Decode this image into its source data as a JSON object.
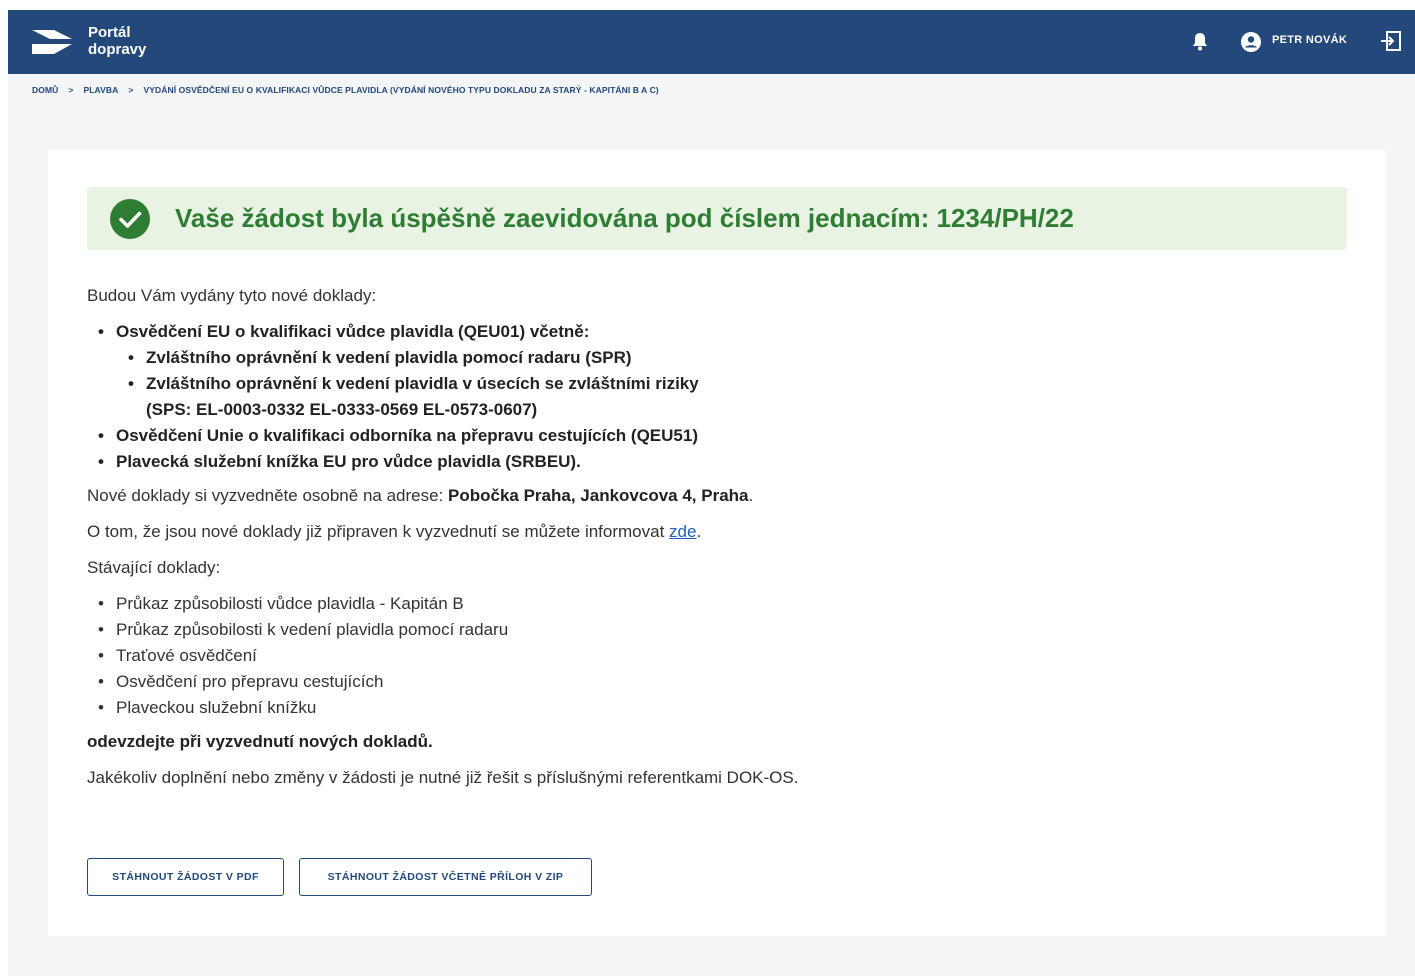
{
  "header": {
    "logo_line1": "Portál",
    "logo_line2": "dopravy",
    "user_name": "PETR NOVÁK",
    "icons": [
      "notification-bell-icon",
      "user-avatar-icon",
      "logout-icon"
    ]
  },
  "breadcrumb": {
    "items": [
      "DOMŮ",
      "PLAVBA",
      "VYDÁNÍ OSVĚDČENÍ EU O KVALIFIKACI VŮDCE PLAVIDLA (VYDÁNÍ NOVÉHO TYPU DOKLADU ZA STARÝ - KAPITÁNI B A C)"
    ],
    "separator": ">"
  },
  "success": {
    "message": "Vaše žádost byla úspěšně zaevidována pod číslem jednacím: 1234/PH/22",
    "icon": "check-circle-icon",
    "color": "#2e7d32",
    "background": "#e8f3e4"
  },
  "content": {
    "intro": "Budou Vám vydány tyto nové doklady:",
    "new_documents": {
      "item1": "Osvědčení EU o kvalifikaci vůdce plavidla (QEU01) včetně:",
      "sub1": "Zvláštního oprávnění k vedení plavidla pomocí radaru (SPR)",
      "sub2_line1": "Zvláštního oprávnění k vedení plavidla v úsecích se zvláštními riziky",
      "sub2_line2": "(SPS: EL-0003-0332 EL-0333-0569 EL-0573-0607)",
      "item2": "Osvědčení Unie o kvalifikaci odborníka na přepravu cestujících (QEU51)",
      "item3": "Plavecká služební knížka EU pro vůdce plavidla (SRBEU)."
    },
    "pickup_prefix": "Nové doklady si vyzvedněte osobně na adrese: ",
    "pickup_address": "Pobočka Praha, Jankovcova 4, Praha",
    "pickup_suffix": ".",
    "notify_prefix": "O tom, že jsou nové doklady již připraven k vyzvednutí se můžete informovat ",
    "notify_link": "zde",
    "notify_suffix": ".",
    "existing_title": "Stávající doklady:",
    "existing": [
      "Průkaz způsobilosti vůdce plavidla - Kapitán B",
      "Průkaz způsobilosti k vedení plavidla pomocí radaru",
      "Traťové osvědčení",
      "Osvědčení pro přepravu cestujících",
      "Plaveckou služební knížku"
    ],
    "return_note": "odevzdejte při vyzvednutí nových dokladů.",
    "changes_note": "Jakékoliv doplnění nebo změny v žádosti je nutné již řešit s příslušnými referentkami DOK-OS."
  },
  "buttons": {
    "download_pdf": "STÁHNOUT ŽÁDOST V PDF",
    "download_zip": "STÁHNOUT ŽÁDOST VČETNĚ PŘÍLOH V ZIP"
  },
  "colors": {
    "brand": "#22497a",
    "link": "#1d5fbf"
  }
}
